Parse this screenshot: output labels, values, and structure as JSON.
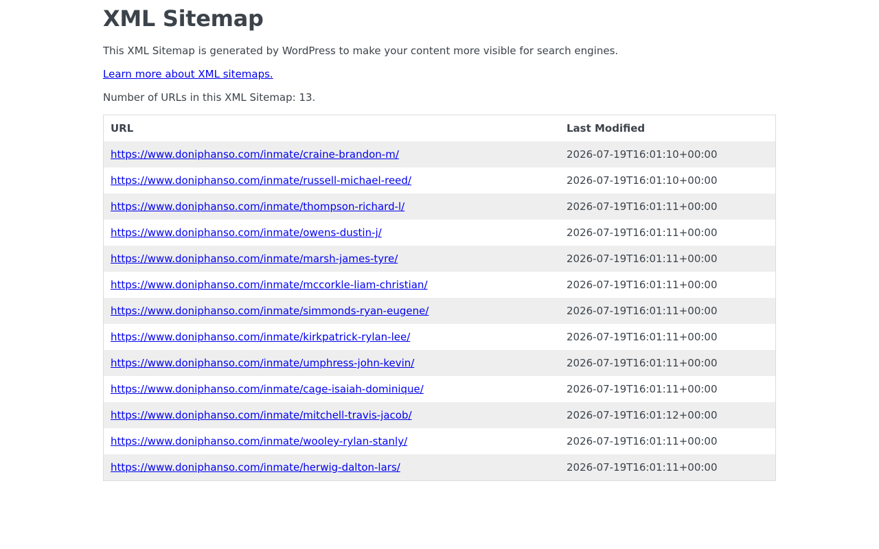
{
  "header": {
    "title": "XML Sitemap",
    "description": "This XML Sitemap is generated by WordPress to make your content more visible for search engines.",
    "learn_more": "Learn more about XML sitemaps.",
    "count_text": "Number of URLs in this XML Sitemap: 13."
  },
  "table": {
    "columns": [
      "URL",
      "Last Modified"
    ],
    "rows": [
      {
        "url": "https://www.doniphanso.com/inmate/craine-brandon-m/",
        "lastmod": "2026-07-19T16:01:10+00:00"
      },
      {
        "url": "https://www.doniphanso.com/inmate/russell-michael-reed/",
        "lastmod": "2026-07-19T16:01:10+00:00"
      },
      {
        "url": "https://www.doniphanso.com/inmate/thompson-richard-l/",
        "lastmod": "2026-07-19T16:01:11+00:00"
      },
      {
        "url": "https://www.doniphanso.com/inmate/owens-dustin-j/",
        "lastmod": "2026-07-19T16:01:11+00:00"
      },
      {
        "url": "https://www.doniphanso.com/inmate/marsh-james-tyre/",
        "lastmod": "2026-07-19T16:01:11+00:00"
      },
      {
        "url": "https://www.doniphanso.com/inmate/mccorkle-liam-christian/",
        "lastmod": "2026-07-19T16:01:11+00:00"
      },
      {
        "url": "https://www.doniphanso.com/inmate/simmonds-ryan-eugene/",
        "lastmod": "2026-07-19T16:01:11+00:00"
      },
      {
        "url": "https://www.doniphanso.com/inmate/kirkpatrick-rylan-lee/",
        "lastmod": "2026-07-19T16:01:11+00:00"
      },
      {
        "url": "https://www.doniphanso.com/inmate/umphress-john-kevin/",
        "lastmod": "2026-07-19T16:01:11+00:00"
      },
      {
        "url": "https://www.doniphanso.com/inmate/cage-isaiah-dominique/",
        "lastmod": "2026-07-19T16:01:11+00:00"
      },
      {
        "url": "https://www.doniphanso.com/inmate/mitchell-travis-jacob/",
        "lastmod": "2026-07-19T16:01:12+00:00"
      },
      {
        "url": "https://www.doniphanso.com/inmate/wooley-rylan-stanly/",
        "lastmod": "2026-07-19T16:01:11+00:00"
      },
      {
        "url": "https://www.doniphanso.com/inmate/herwig-dalton-lars/",
        "lastmod": "2026-07-19T16:01:11+00:00"
      }
    ]
  },
  "colors": {
    "link": "#0000ee",
    "text": "#3c434a",
    "row_stripe": "#eeeeee",
    "border": "#dcdcde"
  }
}
